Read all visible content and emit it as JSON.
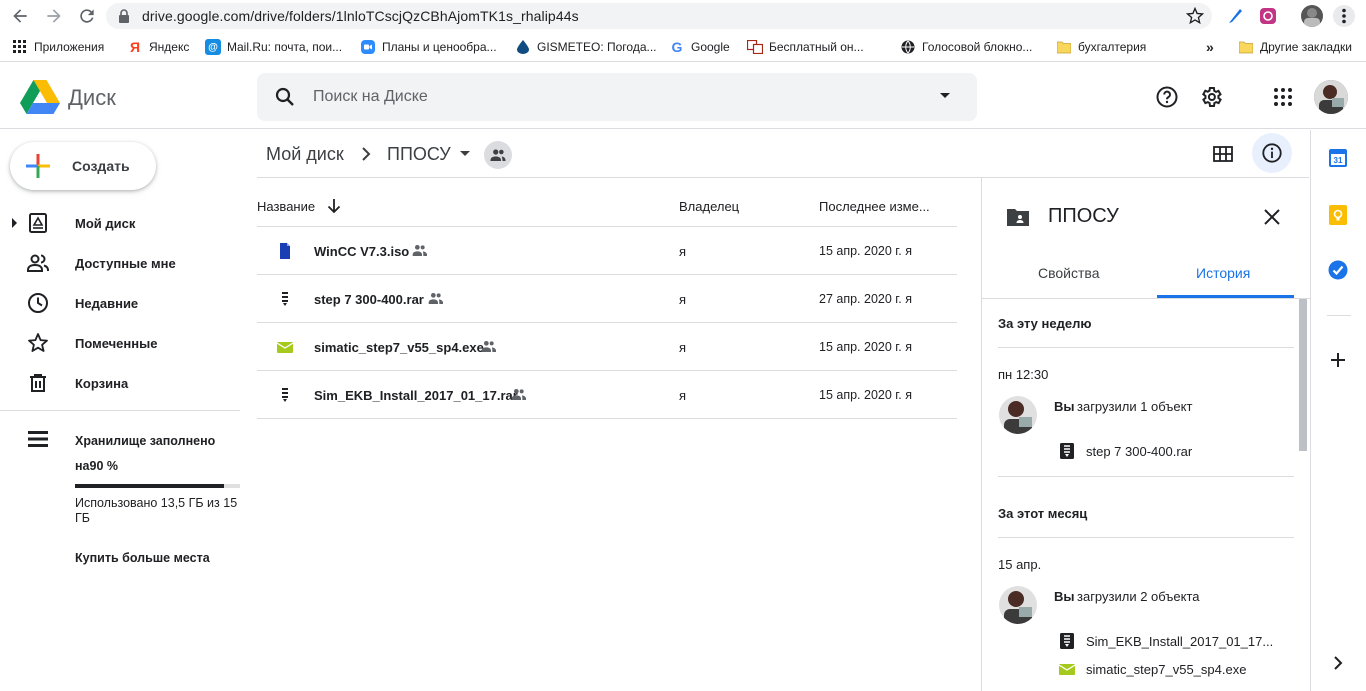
{
  "browser": {
    "url": "drive.google.com/drive/folders/1lnloTCscjQzCBhAjomTK1s_rhalip44s",
    "bookmarks": [
      {
        "label": "Приложения",
        "icon": "apps-grid-icon"
      },
      {
        "label": "Яндекс",
        "icon": "yandex-icon"
      },
      {
        "label": "Mail.Ru: почта, пои...",
        "icon": "mailru-icon"
      },
      {
        "label": "Планы и ценообра...",
        "icon": "zoom-icon"
      },
      {
        "label": "GISMETEO: Погода...",
        "icon": "gismeteo-icon"
      },
      {
        "label": "Google",
        "icon": "google-icon"
      },
      {
        "label": "Бесплатный он...",
        "icon": "translate-icon"
      },
      {
        "label": "Голосовой блокно...",
        "icon": "globe-icon"
      },
      {
        "label": "бухгалтерия",
        "icon": "folder-icon"
      }
    ],
    "bookmarks_overflow": "»",
    "other_bookmarks": "Другие закладки"
  },
  "header": {
    "app_name": "Диск",
    "search_placeholder": "Поиск на Диске"
  },
  "sidebar": {
    "create_label": "Создать",
    "items": [
      {
        "label": "Мой диск",
        "icon": "my-drive-icon"
      },
      {
        "label": "Доступные мне",
        "icon": "shared-people-icon"
      },
      {
        "label": "Недавние",
        "icon": "clock-icon"
      },
      {
        "label": "Помеченные",
        "icon": "star-icon"
      },
      {
        "label": "Корзина",
        "icon": "trash-icon"
      }
    ],
    "storage": {
      "title": "Хранилище заполнено",
      "percent_text": "на90 %",
      "fill_fraction": 0.9,
      "usage_text": "Использовано 13,5 ГБ из 15 ГБ",
      "buy_more": "Купить больше места"
    }
  },
  "breadcrumb": {
    "root": "Мой диск",
    "separator": "›",
    "current": "ППОСУ"
  },
  "file_list": {
    "columns": {
      "name": "Название",
      "owner": "Владелец",
      "modified": "Последнее изме..."
    },
    "rows": [
      {
        "name": "WinCC V7.3.iso",
        "owner": "я",
        "modified": "15 апр. 2020 г. я",
        "icon": "iso-file-icon"
      },
      {
        "name": "step 7 300-400.rar",
        "owner": "я",
        "modified": "27 апр. 2020 г. я",
        "icon": "archive-file-icon"
      },
      {
        "name": "simatic_step7_v55_sp4.exe",
        "owner": "я",
        "modified": "15 апр. 2020 г. я",
        "icon": "exe-file-icon"
      },
      {
        "name": "Sim_EKB_Install_2017_01_17.rar",
        "owner": "я",
        "modified": "15 апр. 2020 г. я",
        "icon": "archive-file-icon"
      }
    ]
  },
  "details": {
    "title": "ППОСУ",
    "tabs": [
      "Свойства",
      "История"
    ],
    "active_tab": "История",
    "sections": [
      {
        "heading": "За эту неделю",
        "time": "пн 12:30",
        "actor": "Вы",
        "action": "загрузили 1 объект",
        "files": [
          "step 7 300-400.rar"
        ]
      },
      {
        "heading": "За этот месяц",
        "time": "15 апр.",
        "actor": "Вы",
        "action": "загрузили 2 объекта",
        "files": [
          "Sim_EKB_Install_2017_01_17...",
          "simatic_step7_v55_sp4.exe"
        ]
      }
    ]
  },
  "colors": {
    "accent_blue": "#1a73e8",
    "divider": "#dadce0",
    "search_bg": "#f1f3f4"
  }
}
